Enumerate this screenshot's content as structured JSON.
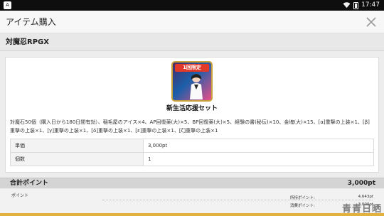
{
  "status_bar": {
    "time": "17:47",
    "app_icon": "A"
  },
  "header": {
    "title": "アイテム購入"
  },
  "app": {
    "name": "対魔忍RPGX"
  },
  "item": {
    "badge": "1回限定",
    "name": "新生活応援セット",
    "description": "対魔石50個（購入日から180日間有効）、稲毛屋のアイス×4、AP回復薬(大)×5、BP回復薬(大)×5、経験の書(秘伝)×10、金塊(大)×15、[α]重撃の上装×1、[β]重撃の上装×1、[γ]重撃の上装×1、[δ]重撃の上装×1、[ε]重撃の上装×1、[ζ]重撃の上装×1",
    "details": [
      {
        "key": "単価",
        "value": "3,000pt"
      },
      {
        "key": "個数",
        "value": "1"
      }
    ]
  },
  "summary": {
    "label": "合計ポイント",
    "total": "3,000pt"
  },
  "points": {
    "label": "ポイント",
    "held_label": "所持ポイント:",
    "held_value": "4,643pt",
    "consumed_label": "消費ポイント:",
    "consumed_value": "3,000pt"
  },
  "watermark": {
    "text": "青青日晒"
  },
  "colors": {
    "badge_red": "#e23a2a",
    "strip_gold": "#e3b23c",
    "status_bar": "#0e0e0e"
  }
}
